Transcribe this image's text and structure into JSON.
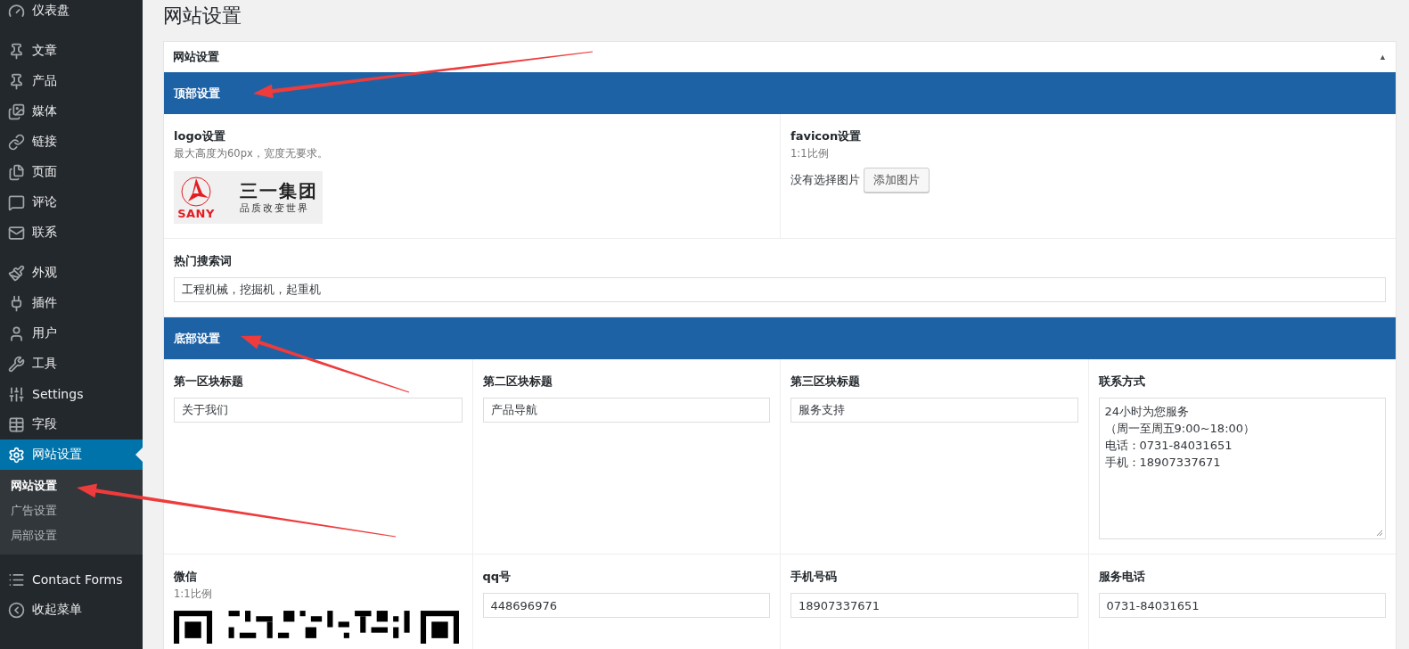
{
  "sidebar": {
    "groups": [
      {
        "items": [
          {
            "label": "仪表盘",
            "selected": false
          }
        ]
      },
      {
        "items": [
          {
            "label": "文章",
            "selected": false
          },
          {
            "label": "产品",
            "selected": false
          },
          {
            "label": "媒体",
            "selected": false
          },
          {
            "label": "链接",
            "selected": false
          },
          {
            "label": "页面",
            "selected": false
          },
          {
            "label": "评论",
            "selected": false
          },
          {
            "label": "联系",
            "selected": false
          }
        ]
      },
      {
        "items": [
          {
            "label": "外观",
            "selected": false
          },
          {
            "label": "插件",
            "selected": false
          },
          {
            "label": "用户",
            "selected": false
          },
          {
            "label": "工具",
            "selected": false
          },
          {
            "label": "Settings",
            "selected": false
          },
          {
            "label": "字段",
            "selected": false
          },
          {
            "label": "网站设置",
            "selected": true,
            "children": [
              {
                "label": "网站设置",
                "selected": true
              },
              {
                "label": "广告设置",
                "selected": false
              },
              {
                "label": "局部设置",
                "selected": false
              }
            ]
          }
        ]
      },
      {
        "items": [
          {
            "label": "Contact Forms",
            "selected": false
          },
          {
            "label": "收起菜单",
            "selected": false
          }
        ]
      }
    ]
  },
  "page_title": "网站设置",
  "panel": {
    "title": "网站设置",
    "toggle": "▲",
    "sections": [
      {
        "title": "顶部设置",
        "fields": [
          {
            "kind": "image",
            "label": "logo设置",
            "description": "最大高度为60px，宽度无要求。",
            "logo": {
              "brand": "SANY",
              "name": "三一集团",
              "slogan": "品质改变世界"
            }
          },
          {
            "kind": "upload",
            "label": "favicon设置",
            "description": "1:1比例",
            "status": "没有选择图片",
            "button": "添加图片"
          },
          {
            "kind": "wide_input",
            "label": "热门搜索词",
            "value": "工程机械，挖掘机，起重机"
          }
        ]
      },
      {
        "title": "底部设置",
        "fields": [
          {
            "kind": "input",
            "label": "第一区块标题",
            "value": "关于我们"
          },
          {
            "kind": "input",
            "label": "第二区块标题",
            "value": "产品导航"
          },
          {
            "kind": "input",
            "label": "第三区块标题",
            "value": "服务支持"
          },
          {
            "kind": "textarea",
            "label": "联系方式",
            "lines": [
              "24小时为您服务",
              "（周一至周五9:00~18:00）",
              "电话：0731-84031651",
              "手机：18907337671"
            ]
          },
          {
            "kind": "qr",
            "label": "微信",
            "description": "1:1比例"
          },
          {
            "kind": "input",
            "label": "qq号",
            "value": "448696976"
          },
          {
            "kind": "input",
            "label": "手机号码",
            "value": "18907337671"
          },
          {
            "kind": "input",
            "label": "服务电话",
            "value": "0731-84031651"
          }
        ]
      }
    ]
  }
}
